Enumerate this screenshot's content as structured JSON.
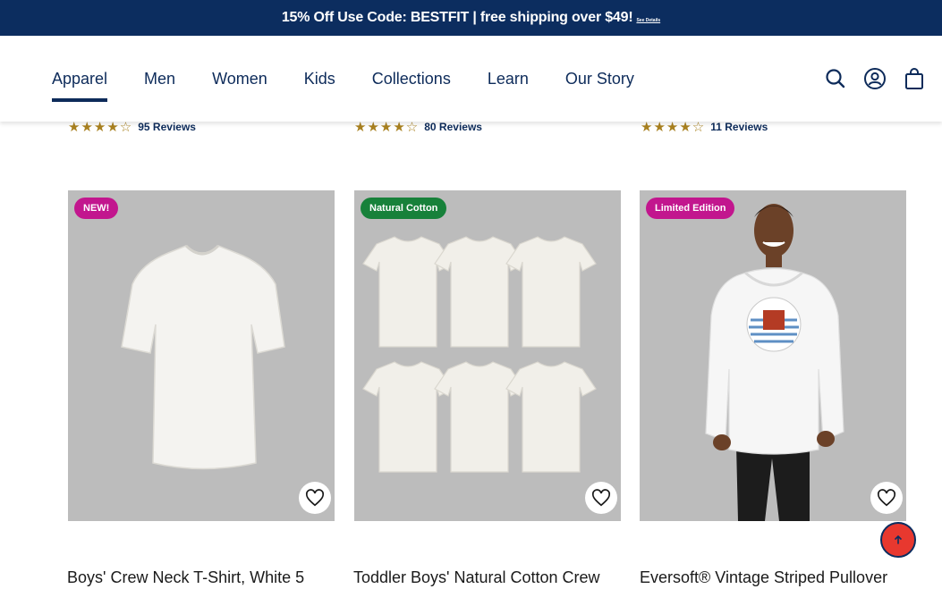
{
  "promo": {
    "text": "15% Off Use Code: BESTFIT | free shipping over $49!",
    "link": "See Details"
  },
  "nav": {
    "items": [
      "Apparel",
      "Men",
      "Women",
      "Kids",
      "Collections",
      "Learn",
      "Our Story"
    ],
    "active": "Apparel"
  },
  "header_icons": [
    "search-icon",
    "account-icon",
    "cart-icon"
  ],
  "reviews": [
    {
      "stars": "★★★★☆",
      "rating": 4.5,
      "count": "95 Reviews"
    },
    {
      "stars": "★★★★☆",
      "rating": 4.5,
      "count": "80 Reviews"
    },
    {
      "stars": "★★★★☆",
      "rating": 4.5,
      "count": "11 Reviews"
    }
  ],
  "products": [
    {
      "badge": "NEW!",
      "badge_color": "#c2168e",
      "title": "Boys' Crew Neck T-Shirt, White 5"
    },
    {
      "badge": "Natural Cotton",
      "badge_color": "#17813a",
      "title": "Toddler Boys' Natural Cotton Crew"
    },
    {
      "badge": "Limited Edition",
      "badge_color": "#c2168e",
      "title": "Eversoft® Vintage Striped Pullover"
    }
  ],
  "colors": {
    "navy": "#0c2d5f",
    "image_bg": "#bcbcbc",
    "star": "#a8801f",
    "chat_button": "#e8382f"
  }
}
